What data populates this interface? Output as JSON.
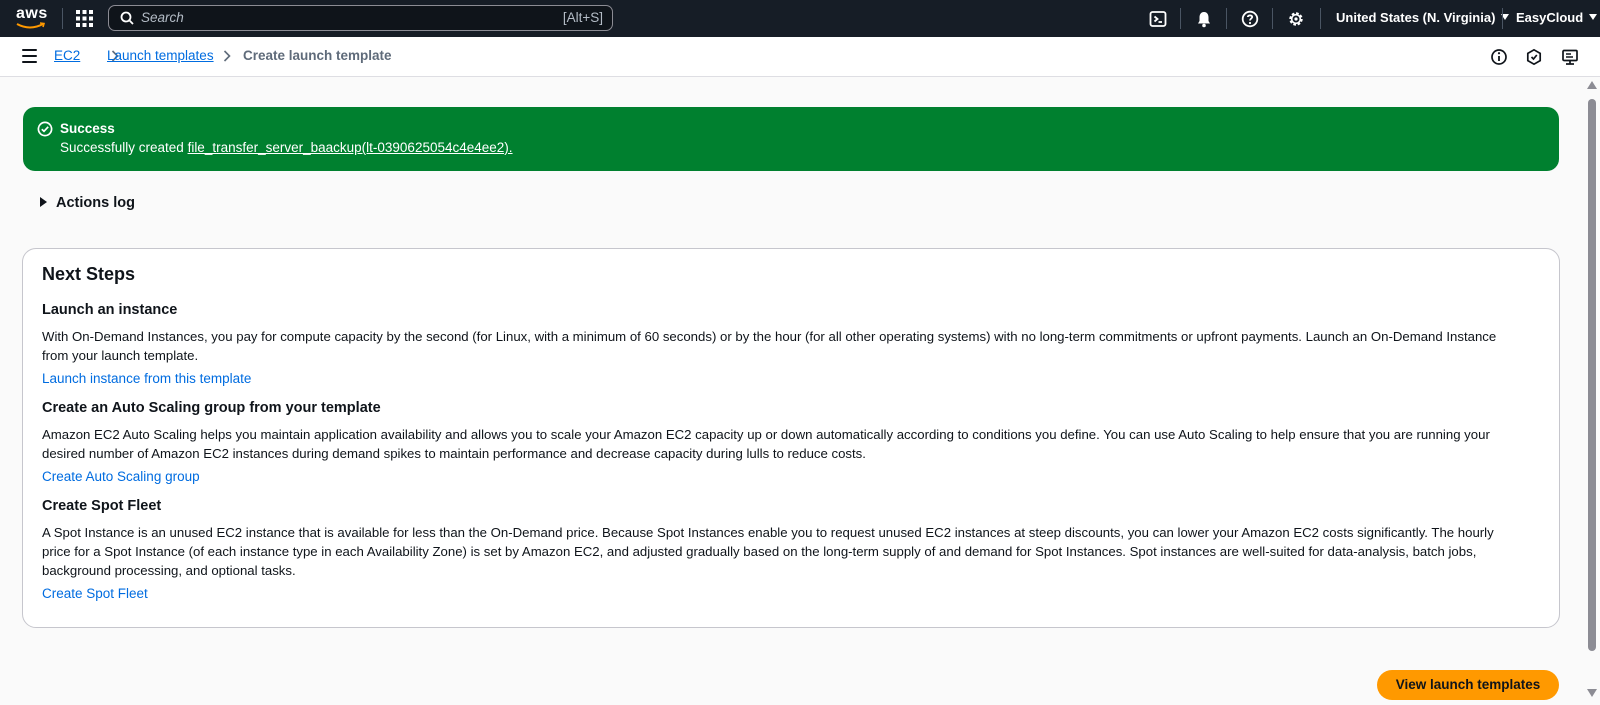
{
  "topnav": {
    "logo_text": "aws",
    "search_placeholder": "Search",
    "search_shortcut": "[Alt+S]",
    "icons": [
      "apps-grid-icon",
      "cloudshell-icon",
      "bell-icon",
      "help-icon",
      "gear-icon"
    ],
    "region": "United States (N. Virginia)",
    "account": "EasyCloud"
  },
  "breadcrumb": {
    "items": [
      "EC2",
      "Launch templates",
      "Create launch template"
    ]
  },
  "flash": {
    "title": "Success",
    "message_prefix": "Successfully created ",
    "message_link": "file_transfer_server_baackup(lt-0390625054c4e4ee2).",
    "color": "#00802f"
  },
  "actions_log": {
    "label": "Actions log"
  },
  "next_steps": {
    "title": "Next Steps",
    "sections": [
      {
        "title": "Launch an instance",
        "text": "With On-Demand Instances, you pay for compute capacity by the second (for Linux, with a minimum of 60 seconds) or by the hour (for all other operating systems) with no long-term commitments or upfront payments. Launch an On-Demand Instance from your launch template.",
        "link": "Launch instance from this template"
      },
      {
        "title": "Create an Auto Scaling group from your template",
        "text": "Amazon EC2 Auto Scaling helps you maintain application availability and allows you to scale your Amazon EC2 capacity up or down automatically according to conditions you define. You can use Auto Scaling to help ensure that you are running your desired number of Amazon EC2 instances during demand spikes to maintain performance and decrease capacity during lulls to reduce costs.",
        "link": "Create Auto Scaling group"
      },
      {
        "title": "Create Spot Fleet",
        "text": "A Spot Instance is an unused EC2 instance that is available for less than the On-Demand price. Because Spot Instances enable you to request unused EC2 instances at steep discounts, you can lower your Amazon EC2 costs significantly. The hourly price for a Spot Instance (of each instance type in each Availability Zone) is set by Amazon EC2, and adjusted gradually based on the long-term supply of and demand for Spot Instances. Spot instances are well-suited for data-analysis, batch jobs, background processing, and optional tasks.",
        "link": "Create Spot Fleet"
      }
    ]
  },
  "primary_button": {
    "label": "View launch templates",
    "color": "#ff9900"
  },
  "colors": {
    "link": "#006ce0",
    "nav_bg": "#161d26"
  }
}
